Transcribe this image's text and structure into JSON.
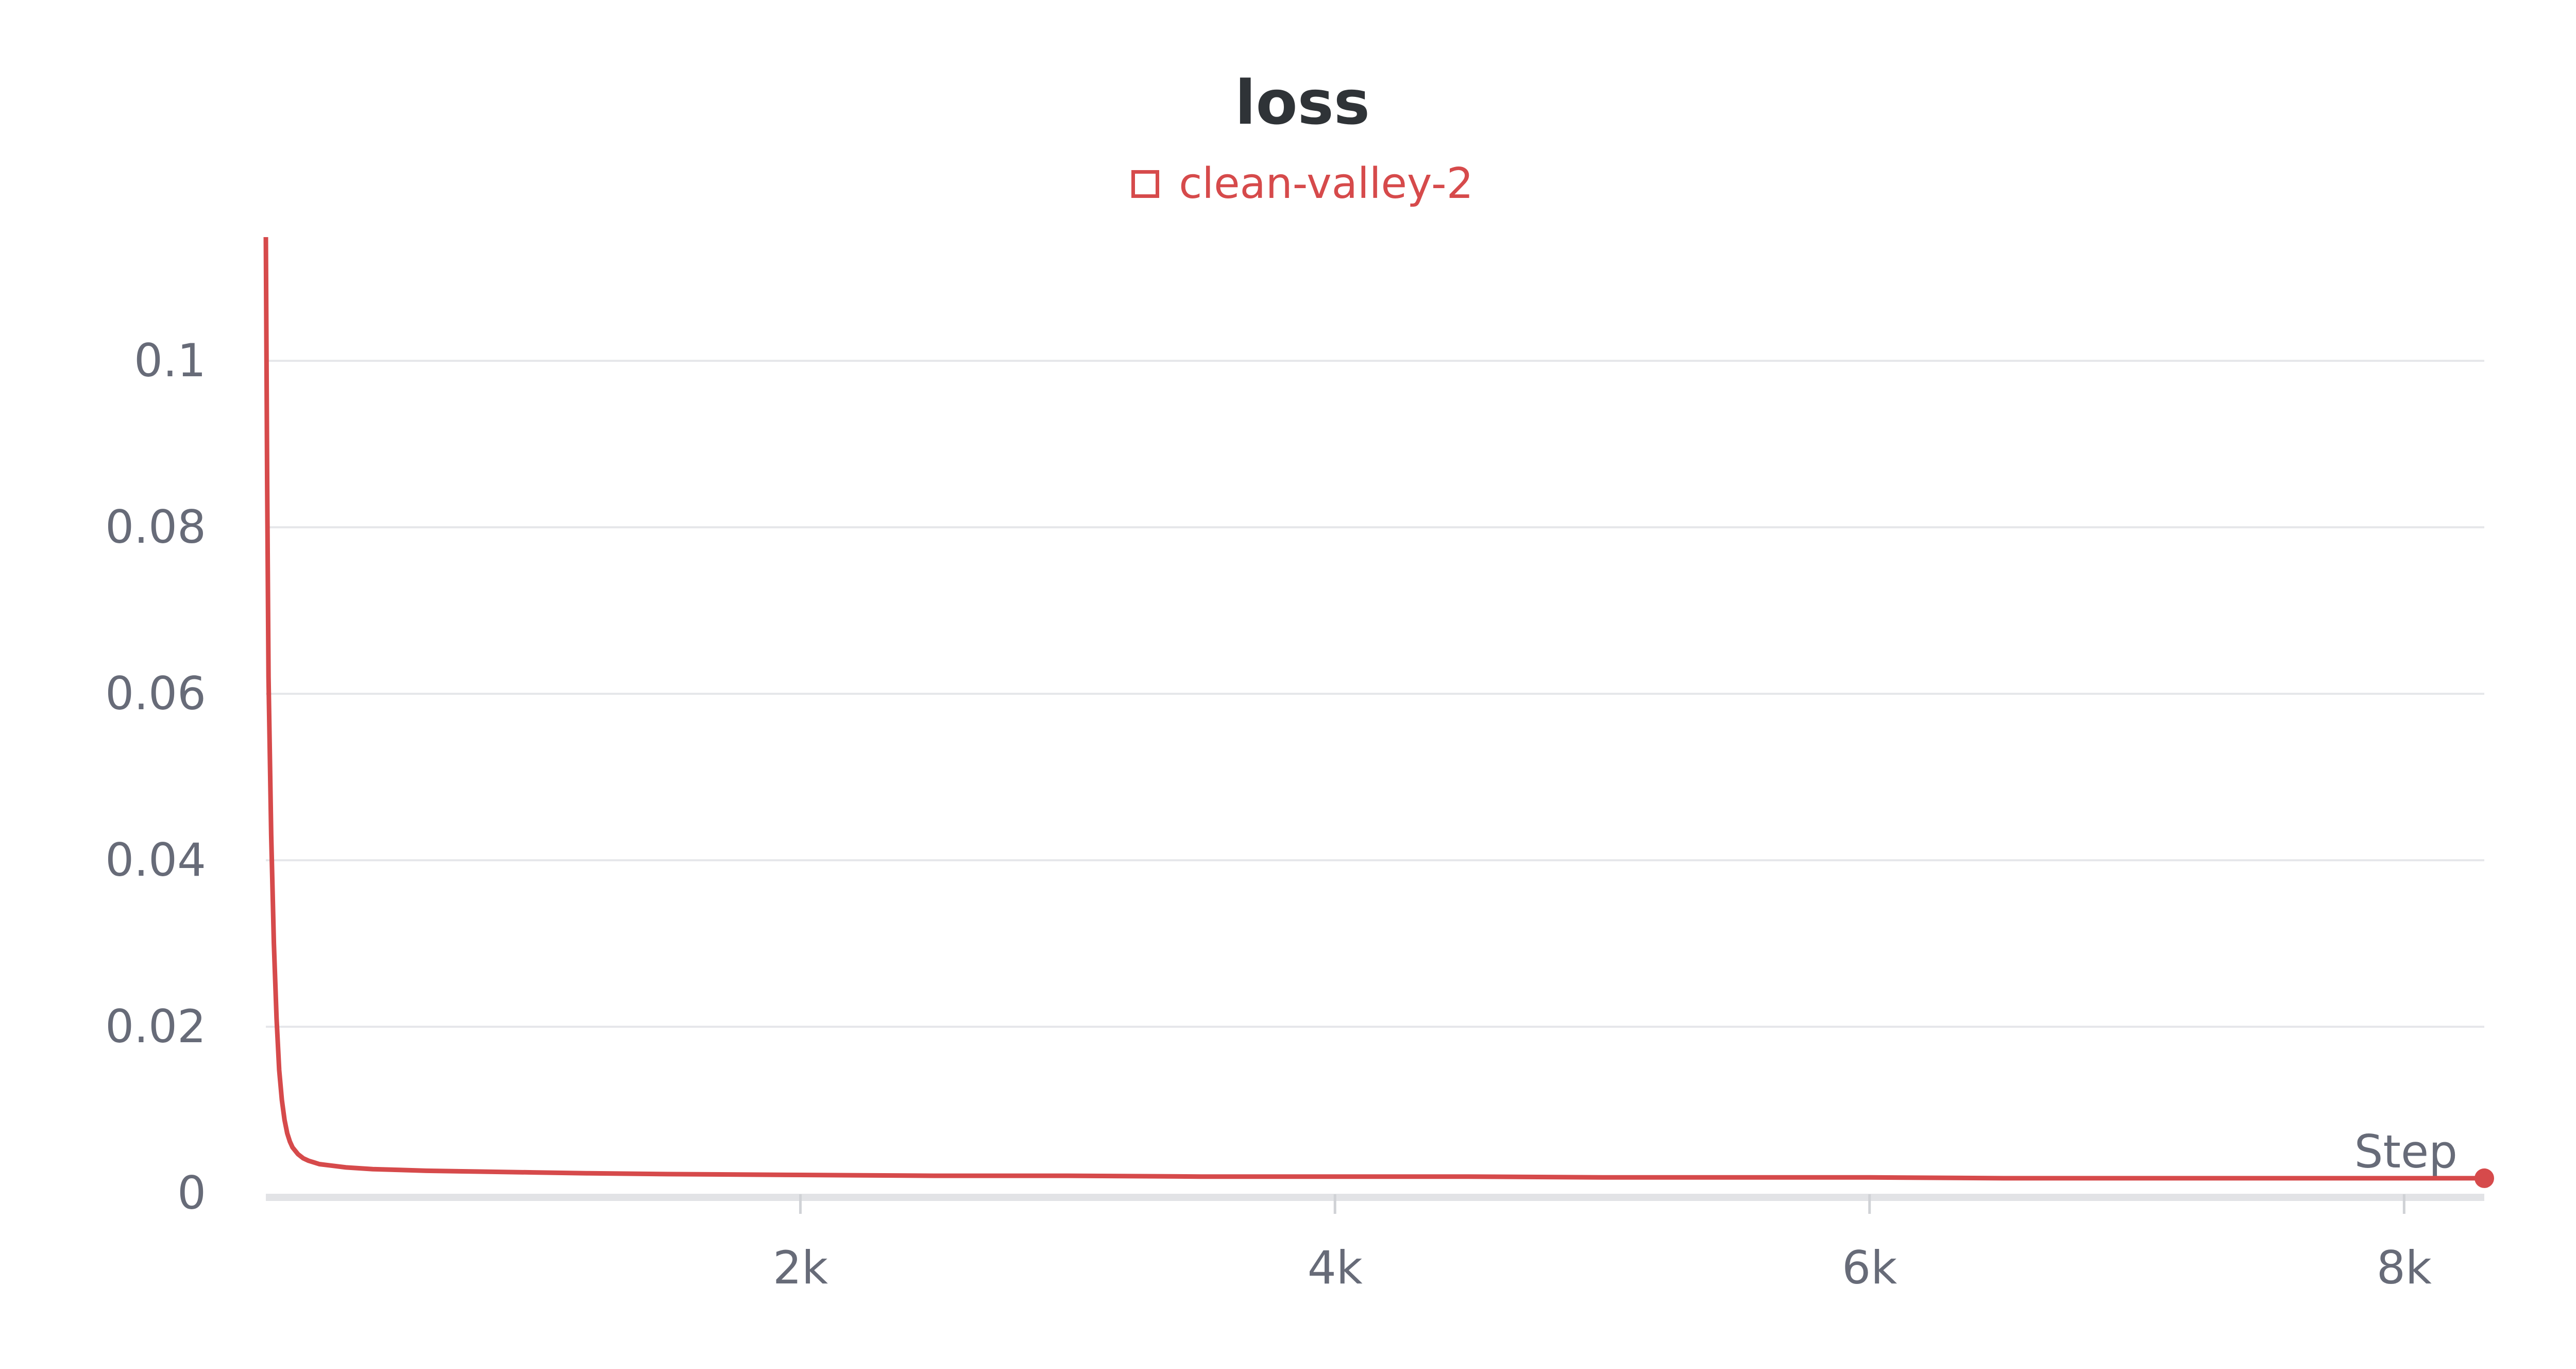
{
  "chart_data": {
    "type": "line",
    "title": "loss",
    "xlabel": "Step",
    "ylabel": "",
    "xlim": [
      0,
      8300
    ],
    "ylim": [
      0,
      0.114
    ],
    "y_ticks": [
      0,
      0.02,
      0.04,
      0.06,
      0.08,
      0.1
    ],
    "y_tick_labels": [
      "0",
      "0.02",
      "0.04",
      "0.06",
      "0.08",
      "0.1"
    ],
    "x_ticks": [
      2000,
      4000,
      6000,
      8000
    ],
    "x_tick_labels": [
      "2k",
      "4k",
      "6k",
      "8k"
    ],
    "grid": true,
    "legend_position": "top-center",
    "series": [
      {
        "name": "clean-valley-2",
        "color": "#d64a4b",
        "x": [
          0,
          5,
          10,
          20,
          30,
          40,
          50,
          60,
          70,
          80,
          90,
          100,
          120,
          140,
          160,
          180,
          200,
          250,
          300,
          400,
          500,
          600,
          800,
          1000,
          1200,
          1500,
          2000,
          2500,
          3000,
          3500,
          4000,
          4500,
          5000,
          5500,
          6000,
          6500,
          7000,
          7500,
          8000,
          8300
        ],
        "y": [
          0.115,
          0.085,
          0.062,
          0.043,
          0.03,
          0.021,
          0.0148,
          0.0112,
          0.0088,
          0.0072,
          0.0062,
          0.0055,
          0.0047,
          0.0042,
          0.0039,
          0.0037,
          0.0035,
          0.0033,
          0.0031,
          0.0029,
          0.0028,
          0.0027,
          0.0026,
          0.0025,
          0.0024,
          0.0023,
          0.0022,
          0.0021,
          0.0021,
          0.002,
          0.002,
          0.002,
          0.0019,
          0.0019,
          0.0019,
          0.0018,
          0.0018,
          0.0018,
          0.0018,
          0.0018
        ]
      }
    ]
  }
}
